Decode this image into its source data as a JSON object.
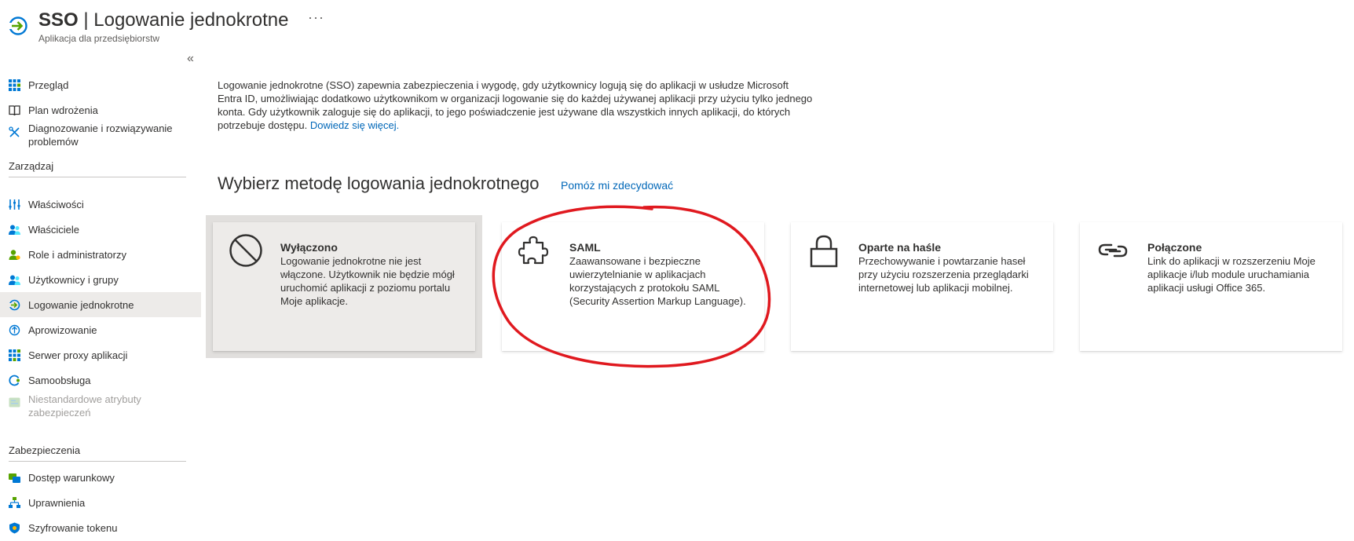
{
  "header": {
    "title_strong": "SSO",
    "title_rest": " | Logowanie jednokrotne",
    "more": "···",
    "subtitle": "Aplikacja dla przedsiębiorstw"
  },
  "sidebar": {
    "collapse": "«",
    "items": [
      {
        "label": "Przegląd",
        "icon": "overview-grid-icon"
      },
      {
        "label": "Plan wdrożenia",
        "icon": "book-icon"
      },
      {
        "label": "Diagnozowanie i rozwiązywanie problemów",
        "icon": "wrench-icon"
      }
    ],
    "manage_heading": "Zarządzaj",
    "manage_items": [
      {
        "label": "Właściwości",
        "icon": "sliders-icon"
      },
      {
        "label": "Właściciele",
        "icon": "owners-icon"
      },
      {
        "label": "Role i administratorzy",
        "icon": "roles-icon"
      },
      {
        "label": "Użytkownicy i grupy",
        "icon": "users-groups-icon"
      },
      {
        "label": "Logowanie jednokrotne",
        "icon": "sso-arrow-icon",
        "active": true
      },
      {
        "label": "Aprowizowanie",
        "icon": "provisioning-icon"
      },
      {
        "label": "Serwer proxy aplikacji",
        "icon": "proxy-grid-icon"
      },
      {
        "label": "Samoobsługa",
        "icon": "self-service-icon"
      },
      {
        "label": "Niestandardowe atrybuty zabezpieczeń",
        "icon": "custom-attributes-icon",
        "disabled": true
      }
    ],
    "security_heading": "Zabezpieczenia",
    "security_items": [
      {
        "label": "Dostęp warunkowy",
        "icon": "conditional-access-icon"
      },
      {
        "label": "Uprawnienia",
        "icon": "permissions-icon"
      },
      {
        "label": "Szyfrowanie tokenu",
        "icon": "shield-icon"
      }
    ]
  },
  "main": {
    "description": "Logowanie jednokrotne (SSO) zapewnia zabezpieczenia i wygodę, gdy użytkownicy logują się do aplikacji w usłudze Microsoft Entra ID, umożliwiając dodatkowo użytkownikom w organizacji logowanie się do każdej używanej aplikacji przy użyciu tylko jednego konta. Gdy użytkownik zaloguje się do aplikacji, to jego poświadczenie jest używane dla wszystkich innych aplikacji, do których potrzebuje dostępu.",
    "learn_more": "Dowiedz się więcej.",
    "section_title": "Wybierz metodę logowania jednokrotnego",
    "help_link": "Pomóż mi zdecydować",
    "tiles": [
      {
        "title": "Wyłączono",
        "description": "Logowanie jednokrotne nie jest włączone. Użytkownik nie będzie mógł uruchomić aplikacji z poziomu portalu Moje aplikacje.",
        "icon": "disabled-circle-icon",
        "selected": true
      },
      {
        "title": "SAML",
        "description": "Zaawansowane i bezpieczne uwierzytelnianie w aplikacjach korzystających z protokołu SAML (Security Assertion Markup Language).",
        "icon": "puzzle-icon"
      },
      {
        "title": "Oparte na haśle",
        "description": "Przechowywanie i powtarzanie haseł przy użyciu rozszerzenia przeglądarki internetowej lub aplikacji mobilnej.",
        "icon": "padlock-icon"
      },
      {
        "title": "Połączone",
        "description": "Link do aplikacji w rozszerzeniu Moje aplikacje i/lub module uruchamiania aplikacji usługi Office 365.",
        "icon": "link-icon"
      }
    ]
  },
  "colors": {
    "accent": "#0067b8",
    "active_nav": "#edebe9",
    "annotation": "#e0191f"
  }
}
